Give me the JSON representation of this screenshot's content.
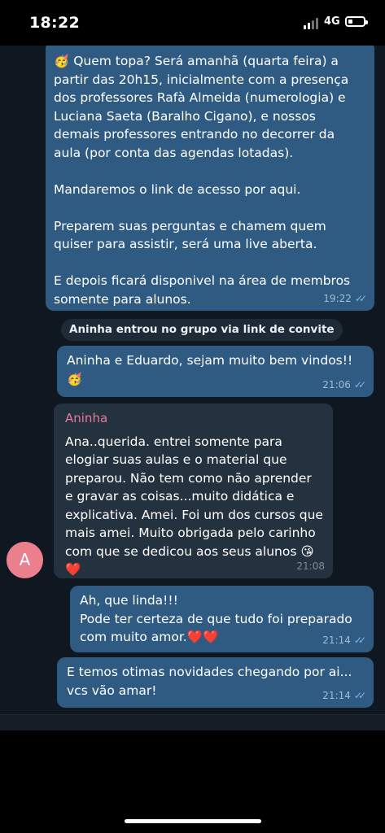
{
  "status_bar": {
    "time": "18:22",
    "network": "4G"
  },
  "messages": [
    {
      "type": "outgoing",
      "text": "🥳 Quem topa? Será amanhã (quarta feira) a partir das 20h15, inicialmente com a presença dos professores Rafà Almeida (numerologia) e Luciana Saeta (Baralho Cigano), e nossos demais professores entrando no decorrer da aula (por conta das agendas lotadas).\n\nMandaremos o link de acesso por aqui.\n\nPreparem suas perguntas e chamem quem quiser para assistir, será uma live aberta.\n\nE depois ficará disponivel na área de membros somente para alunos.",
      "time": "19:22"
    },
    {
      "type": "service",
      "text": "Aninha entrou no grupo via link de convite"
    },
    {
      "type": "outgoing",
      "text": "Aninha e Eduardo,  sejam muito bem vindos!!\n🥳",
      "time": "21:06"
    },
    {
      "type": "incoming",
      "sender": "Aninha",
      "avatar_letter": "A",
      "text": "Ana..querida. entrei somente para elogiar suas aulas e o material que preparou. Não tem como não aprender e gravar as coisas...muito didática e explicativa. Amei. Foi um dos cursos que mais amei. Muito obrigada pelo carinho com que se dedicou aos seus alunos 😘❤️",
      "time": "21:08"
    },
    {
      "type": "outgoing",
      "text": "Ah, que linda!!!\nPode ter certeza de que tudo foi preparado com muito amor.❤️❤️",
      "time": "21:14"
    },
    {
      "type": "outgoing",
      "text": "E temos otimas novidades chegando por ai...\nvcs vão amar!",
      "time": "21:14"
    }
  ],
  "colors": {
    "outgoing_bubble": "#2f5b82",
    "incoming_bubble": "#24323f",
    "background": "#0f1820",
    "sender_name": "#e77a98",
    "avatar": "#eb7f8e"
  }
}
